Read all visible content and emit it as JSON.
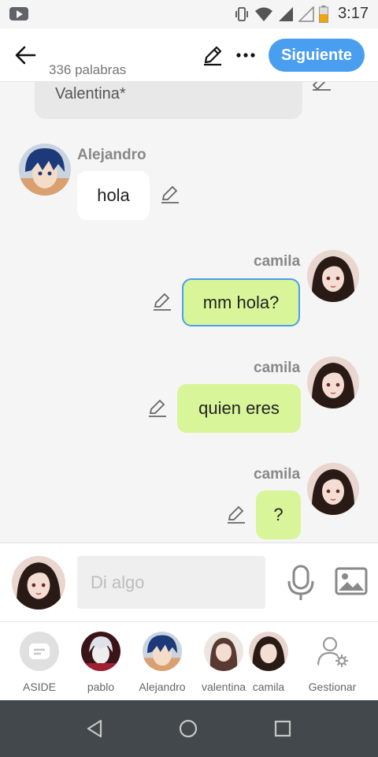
{
  "status_bar": {
    "time": "3:17"
  },
  "header": {
    "word_count": "336 palabras",
    "next_label": "Siguiente"
  },
  "chat": {
    "previous_fragment": "Valentina*",
    "messages": [
      {
        "sender": "Alejandro",
        "text": "hola",
        "side": "left"
      },
      {
        "sender": "camila",
        "text": "mm hola?",
        "side": "right",
        "selected": true
      },
      {
        "sender": "camila",
        "text": "quien eres",
        "side": "right"
      },
      {
        "sender": "camila",
        "text": "?",
        "side": "right"
      }
    ]
  },
  "input": {
    "placeholder": "Di algo"
  },
  "characters": [
    {
      "name": "ASIDE"
    },
    {
      "name": "pablo"
    },
    {
      "name": "Alejandro"
    },
    {
      "name": "valentina"
    },
    {
      "name": "camila"
    },
    {
      "name": "Gestionar"
    }
  ],
  "colors": {
    "accent": "#4a9ef0",
    "bubble_green": "#d9f59a",
    "bubble_white": "#ffffff",
    "nav_bar": "#43484c"
  }
}
